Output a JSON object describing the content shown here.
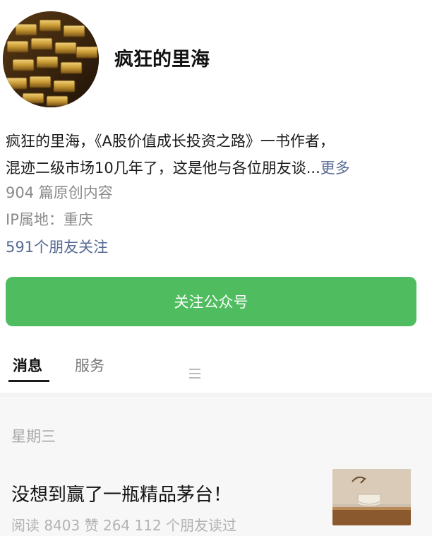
{
  "profile": {
    "account_name": "疯狂的里海",
    "description_line1": "疯狂的里海，《A股价值成长投资之路》一书作者，",
    "description_line2": "混迹二级市场10几年了，这是他与各位朋友谈...",
    "more_label": "更多",
    "original_count": "904 篇原创内容",
    "ip_location": "IP属地：重庆",
    "friends_following": "591个朋友关注",
    "follow_button": "关注公众号"
  },
  "tabs": [
    {
      "label": "消息",
      "active": true
    },
    {
      "label": "服务",
      "active": false,
      "icon": "menu-icon"
    }
  ],
  "feed": {
    "day_label": "星期三",
    "article": {
      "title": "没想到赢了一瓶精品茅台！",
      "stats": "阅读 8403  赞 264  112 个朋友读过",
      "thumbnail_icon": "tea-cup-image"
    }
  },
  "colors": {
    "follow_button_bg": "#4fbd5f",
    "link_blue": "#576b95",
    "muted_gray": "#8a8a8a"
  }
}
